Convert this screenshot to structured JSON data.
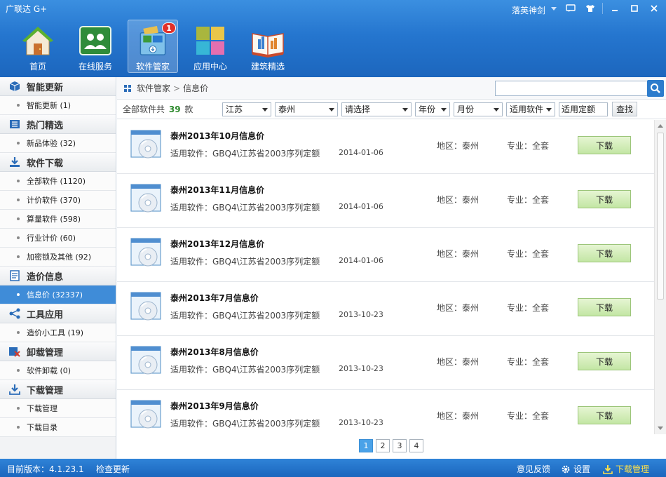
{
  "window": {
    "title": "广联达 G+",
    "user": "落英神剑",
    "controls": [
      "msg",
      "skin",
      "min",
      "max",
      "close"
    ]
  },
  "nav": [
    {
      "label": "首页",
      "icon": "home-icon",
      "active": false
    },
    {
      "label": "在线服务",
      "icon": "online-service-icon",
      "active": false
    },
    {
      "label": "软件管家",
      "icon": "software-manager-icon",
      "active": true,
      "badge": "1"
    },
    {
      "label": "应用中心",
      "icon": "app-center-icon",
      "active": false
    },
    {
      "label": "建筑精选",
      "icon": "building-book-icon",
      "active": false
    }
  ],
  "sidebar": {
    "groups": [
      {
        "title": "智能更新",
        "icon": "cube-icon",
        "items": [
          "智能更新 (1)"
        ]
      },
      {
        "title": "热门精选",
        "icon": "list-icon",
        "items": [
          "新品体验 (32)"
        ]
      },
      {
        "title": "软件下载",
        "icon": "download-icon",
        "items": [
          "全部软件 (1120)",
          "计价软件 (370)",
          "算量软件 (598)",
          "行业计价 (60)",
          "加密锁及其他 (92)"
        ]
      },
      {
        "title": "造价信息",
        "icon": "document-icon",
        "items": [
          "信息价 (32337)"
        ]
      },
      {
        "title": "工具应用",
        "icon": "share-icon",
        "items": [
          "造价小工具 (19)"
        ]
      },
      {
        "title": "卸载管理",
        "icon": "uninstall-icon",
        "items": [
          "软件卸载 (0)"
        ]
      },
      {
        "title": "下载管理",
        "icon": "download-manage-icon",
        "items": [
          "下载管理",
          "下载目录"
        ]
      }
    ],
    "active_item": "信息价 (32337)"
  },
  "breadcrumb": {
    "root": "软件管家",
    "sep": ">",
    "current": "信息价"
  },
  "search": {
    "value": "",
    "placeholder": ""
  },
  "filter": {
    "total_prefix": "全部软件共",
    "total_count": "39",
    "total_suffix": "款",
    "province": "江苏",
    "city": "泰州",
    "third": "请选择",
    "year": "年份",
    "month": "月份",
    "software": "适用软件",
    "quota": "适用定额",
    "find": "查找"
  },
  "rows": [
    {
      "title": "泰州2013年10月信息价",
      "soft": "适用软件：GBQ4\\江苏省2003序列定额",
      "date": "2014-01-06",
      "region": "地区：泰州",
      "major": "专业：全套",
      "btn": "下载"
    },
    {
      "title": "泰州2013年11月信息价",
      "soft": "适用软件：GBQ4\\江苏省2003序列定额",
      "date": "2014-01-06",
      "region": "地区：泰州",
      "major": "专业：全套",
      "btn": "下载"
    },
    {
      "title": "泰州2013年12月信息价",
      "soft": "适用软件：GBQ4\\江苏省2003序列定额",
      "date": "2014-01-06",
      "region": "地区：泰州",
      "major": "专业：全套",
      "btn": "下载"
    },
    {
      "title": "泰州2013年7月信息价",
      "soft": "适用软件：GBQ4\\江苏省2003序列定额",
      "date": "2013-10-23",
      "region": "地区：泰州",
      "major": "专业：全套",
      "btn": "下载"
    },
    {
      "title": "泰州2013年8月信息价",
      "soft": "适用软件：GBQ4\\江苏省2003序列定额",
      "date": "2013-10-23",
      "region": "地区：泰州",
      "major": "专业：全套",
      "btn": "下载"
    },
    {
      "title": "泰州2013年9月信息价",
      "soft": "适用软件：GBQ4\\江苏省2003序列定额",
      "date": "2013-10-23",
      "region": "地区：泰州",
      "major": "专业：全套",
      "btn": "下载"
    }
  ],
  "pager": {
    "pages": [
      "1",
      "2",
      "3",
      "4"
    ],
    "current": "1"
  },
  "status": {
    "version": "目前版本：4.1.23.1",
    "check": "检查更新",
    "feedback": "意见反馈",
    "settings": "设置",
    "download_manage": "下载管理"
  },
  "colors": {
    "titlebar": "#2576cf",
    "active_item": "#3f8cd8",
    "download_btn": "#c3e6a4",
    "accent_count": "#2d8a2d",
    "status_highlight": "#ffe04a"
  }
}
